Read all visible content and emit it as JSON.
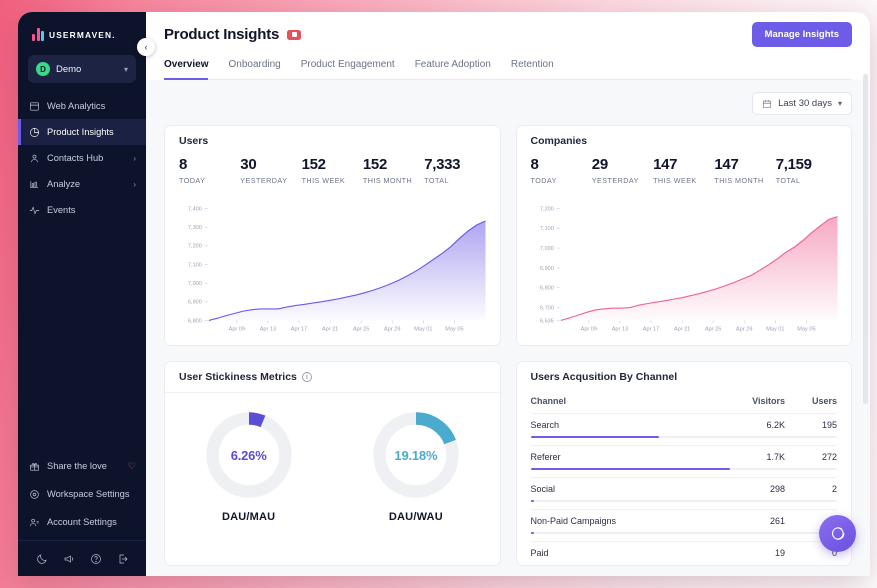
{
  "brand": {
    "name": "USERMAVEN.",
    "accent_purple": "#6c5ce7",
    "accent_pink": "#f5558d",
    "accent_cyan": "#55c9f0"
  },
  "sidebar": {
    "workspace": {
      "initial": "D",
      "name": "Demo"
    },
    "items": [
      {
        "label": "Web Analytics",
        "icon": "browser-icon",
        "active": false,
        "expandable": false
      },
      {
        "label": "Product Insights",
        "icon": "pie-chart-icon",
        "active": true,
        "expandable": false
      },
      {
        "label": "Contacts Hub",
        "icon": "user-icon",
        "active": false,
        "expandable": true
      },
      {
        "label": "Analyze",
        "icon": "chart-icon",
        "active": false,
        "expandable": true
      },
      {
        "label": "Events",
        "icon": "pulse-icon",
        "active": false,
        "expandable": false
      }
    ],
    "bottom_items": [
      {
        "label": "Share the love",
        "icon": "gift-icon",
        "trailing": "heart-icon"
      },
      {
        "label": "Workspace Settings",
        "icon": "settings-icon",
        "trailing": ""
      },
      {
        "label": "Account Settings",
        "icon": "account-icon",
        "trailing": ""
      }
    ],
    "footer_icons": [
      "moon-icon",
      "megaphone-icon",
      "help-icon",
      "logout-icon"
    ]
  },
  "header": {
    "title": "Product Insights",
    "video_badge": "video-icon",
    "manage_button": "Manage Insights",
    "tabs": [
      {
        "label": "Overview",
        "active": true
      },
      {
        "label": "Onboarding",
        "active": false
      },
      {
        "label": "Product Engagement",
        "active": false
      },
      {
        "label": "Feature Adoption",
        "active": false
      },
      {
        "label": "Retention",
        "active": false
      }
    ],
    "date_range": "Last 30 days"
  },
  "users_card": {
    "title": "Users",
    "metrics": [
      {
        "value": "8",
        "label": "TODAY"
      },
      {
        "value": "30",
        "label": "YESTERDAY"
      },
      {
        "value": "152",
        "label": "THIS WEEK"
      },
      {
        "value": "152",
        "label": "THIS MONTH"
      },
      {
        "value": "7,333",
        "label": "TOTAL"
      }
    ]
  },
  "companies_card": {
    "title": "Companies",
    "metrics": [
      {
        "value": "8",
        "label": "TODAY"
      },
      {
        "value": "29",
        "label": "YESTERDAY"
      },
      {
        "value": "147",
        "label": "THIS WEEK"
      },
      {
        "value": "147",
        "label": "THIS MONTH"
      },
      {
        "value": "7,159",
        "label": "TOTAL"
      }
    ]
  },
  "stickiness_card": {
    "title": "User Stickiness Metrics",
    "info_icon": "info-icon",
    "donuts": [
      {
        "value": "6.26%",
        "percent": 6.26,
        "label": "DAU/MAU",
        "color": "#5b4dd6"
      },
      {
        "value": "19.18%",
        "percent": 19.18,
        "label": "DAU/WAU",
        "color": "#4babce"
      }
    ]
  },
  "acquisition_card": {
    "title": "Users Acqusition By Channel",
    "columns": [
      "Channel",
      "Visitors",
      "Users"
    ],
    "rows": [
      {
        "channel": "Search",
        "visitors": "6.2K",
        "users": "195",
        "bar": 42
      },
      {
        "channel": "Referer",
        "visitors": "1.7K",
        "users": "272",
        "bar": 65
      },
      {
        "channel": "Social",
        "visitors": "298",
        "users": "2",
        "bar": 1.2
      },
      {
        "channel": "Non-Paid Campaigns",
        "visitors": "261",
        "users": "",
        "bar": 1.0
      },
      {
        "channel": "Paid",
        "visitors": "19",
        "users": "0",
        "bar": 0.3
      }
    ]
  },
  "chart_data": [
    {
      "type": "area",
      "title": "Users",
      "xlabel": "",
      "ylabel": "",
      "ylim": [
        6800,
        7400
      ],
      "yticks": [
        "6,800",
        "6,900",
        "7,000",
        "7,100",
        "7,200",
        "7,300",
        "7,400"
      ],
      "xticks": [
        "Apr 09",
        "Apr 13",
        "Apr 17",
        "Apr 21",
        "Apr 25",
        "Apr 29",
        "May 01",
        "May 05"
      ],
      "grid": false,
      "legend": "none",
      "color": "#6c5ce7",
      "series": [
        {
          "name": "Users",
          "values": [
            6800,
            6812,
            6826,
            6838,
            6850,
            6858,
            6862,
            6862,
            6862,
            6872,
            6880,
            6886,
            6893,
            6900,
            6908,
            6916,
            6926,
            6936,
            6948,
            6962,
            6978,
            6996,
            7016,
            7040,
            7066,
            7096,
            7128,
            7160,
            7196,
            7240,
            7280,
            7312,
            7333
          ]
        }
      ]
    },
    {
      "type": "area",
      "title": "Companies",
      "xlabel": "",
      "ylabel": "",
      "ylim": [
        6635,
        7200
      ],
      "yticks": [
        "6,635",
        "6,700",
        "6,800",
        "6,900",
        "7,000",
        "7,100",
        "7,200"
      ],
      "xticks": [
        "Apr 09",
        "Apr 13",
        "Apr 17",
        "Apr 21",
        "Apr 25",
        "Apr 29",
        "May 01",
        "May 05"
      ],
      "grid": false,
      "legend": "none",
      "color": "#f06292",
      "series": [
        {
          "name": "Companies",
          "values": [
            6635,
            6648,
            6662,
            6676,
            6688,
            6694,
            6697,
            6697,
            6700,
            6712,
            6720,
            6727,
            6734,
            6742,
            6750,
            6760,
            6770,
            6782,
            6795,
            6810,
            6826,
            6844,
            6862,
            6888,
            6915,
            6945,
            6978,
            7005,
            7038,
            7078,
            7112,
            7145,
            7159
          ]
        }
      ]
    },
    {
      "type": "pie",
      "title": "DAU/MAU",
      "labels": [
        "DAU/MAU",
        "Remainder"
      ],
      "values": [
        6.26,
        93.74
      ],
      "colors": [
        "#5b4dd6",
        "#eef0f4"
      ]
    },
    {
      "type": "pie",
      "title": "DAU/WAU",
      "labels": [
        "DAU/WAU",
        "Remainder"
      ],
      "values": [
        19.18,
        80.82
      ],
      "colors": [
        "#4babce",
        "#eef0f4"
      ]
    }
  ]
}
